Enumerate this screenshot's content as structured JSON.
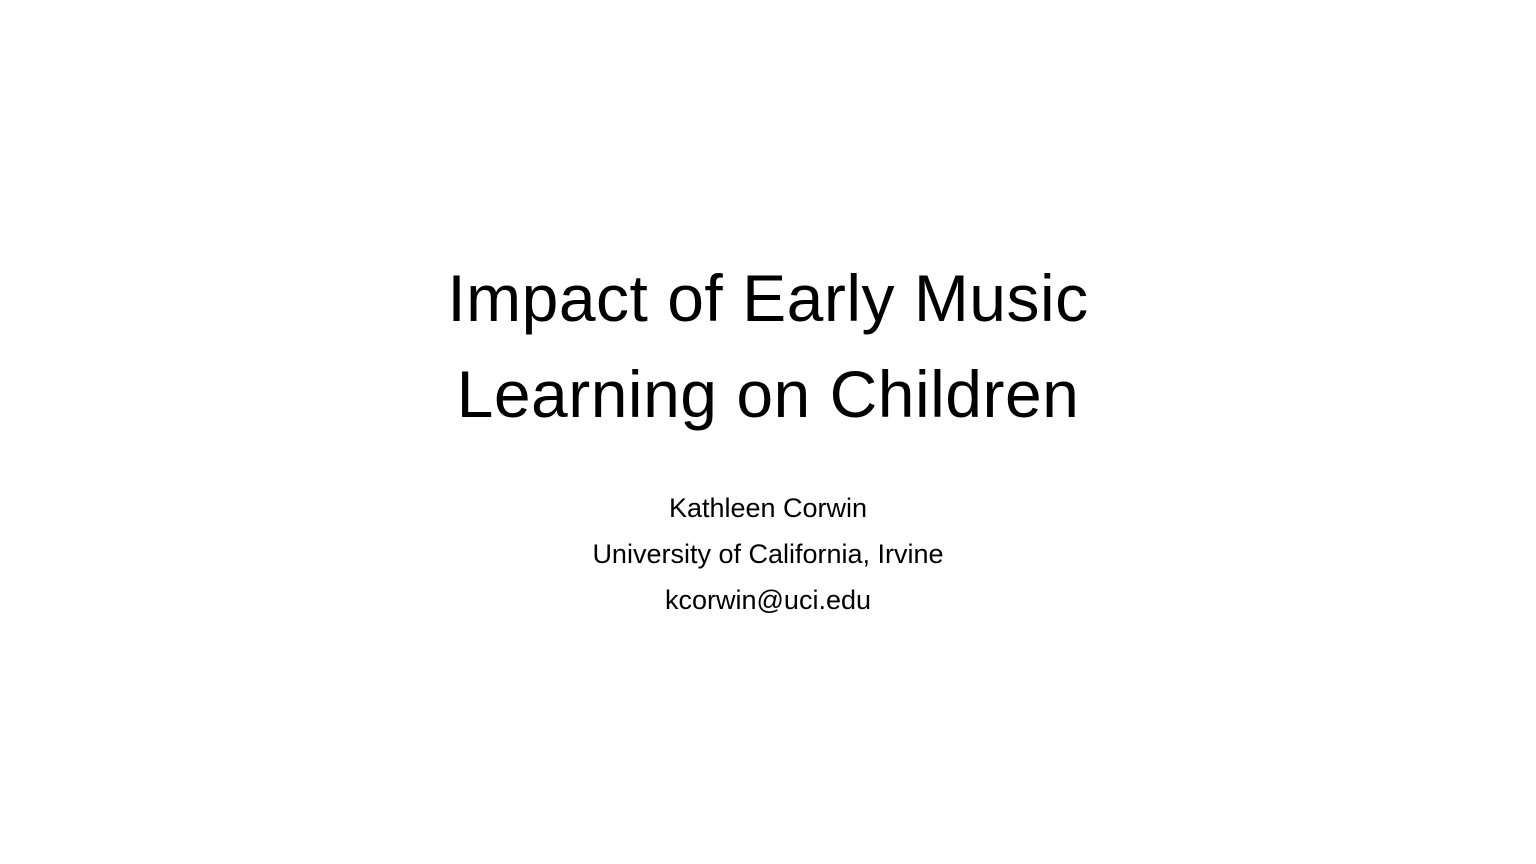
{
  "slide": {
    "title_lines": [
      "Impact of Early Music",
      "Learning on Children"
    ],
    "author": "Kathleen Corwin",
    "affiliation": "University of California, Irvine",
    "email": "kcorwin@uci.edu"
  }
}
